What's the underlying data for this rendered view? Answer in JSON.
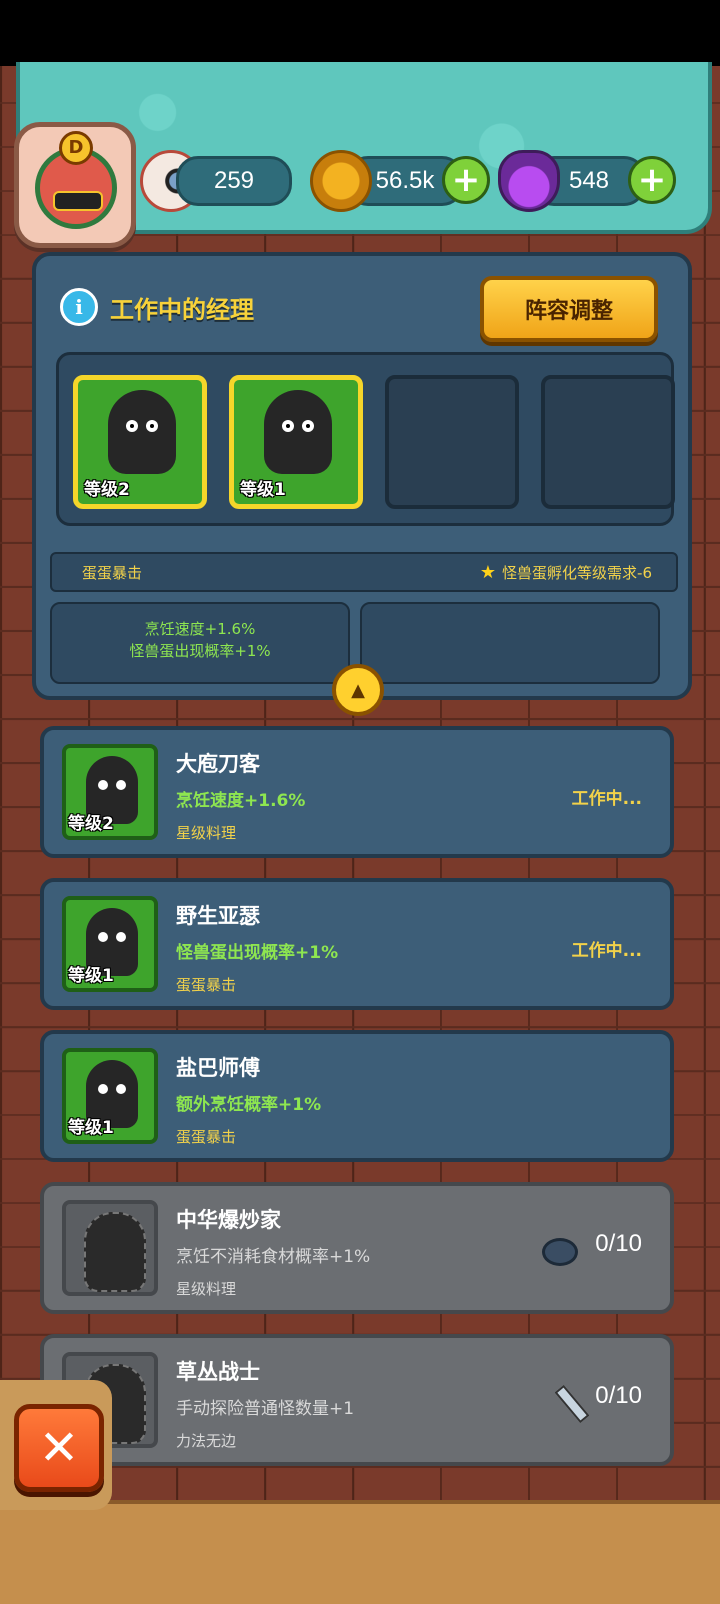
{
  "header": {
    "avatar_letter": "D",
    "eyeballs": "259",
    "coins": "56.5k",
    "potions": "548"
  },
  "panel": {
    "title": "工作中的经理",
    "formation_button": "阵容调整",
    "slots": [
      {
        "level": "等级2",
        "filled": true
      },
      {
        "level": "等级1",
        "filled": true
      },
      {
        "filled": false
      },
      {
        "filled": false
      }
    ],
    "bonus_left": "蛋蛋暴击",
    "bonus_right": "怪兽蛋孵化等级需求-6",
    "effects": [
      "烹饪速度+1.6%",
      "怪兽蛋出现概率+1%"
    ]
  },
  "managers": [
    {
      "name": "大庖刀客",
      "effect": "烹饪速度+1.6%",
      "skill": "星级料理",
      "level": "等级2",
      "status": "工作中..."
    },
    {
      "name": "野生亚瑟",
      "effect": "怪兽蛋出现概率+1%",
      "skill": "蛋蛋暴击",
      "level": "等级1",
      "status": "工作中..."
    },
    {
      "name": "盐巴师傅",
      "effect": "额外烹饪概率+1%",
      "skill": "蛋蛋暴击",
      "level": "等级1",
      "status": ""
    },
    {
      "name": "中华爆炒家",
      "effect": "烹饪不消耗食材概率+1%",
      "skill": "星级料理",
      "progress": "0/10",
      "icon": "pan-icon"
    },
    {
      "name": "草丛战士",
      "effect": "手动探险普通怪数量+1",
      "skill": "力法无边",
      "progress": "0/10",
      "icon": "knife-icon"
    }
  ],
  "colors": {
    "accent_yellow": "#f2d24a",
    "effect_green": "#8ee650",
    "panel_blue": "#3d5e78"
  }
}
